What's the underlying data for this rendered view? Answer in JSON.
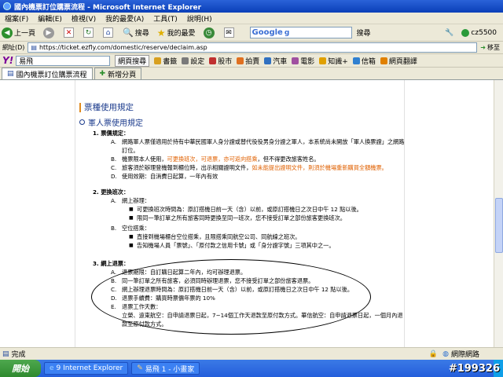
{
  "window": {
    "title": "國內機票訂位購票流程 - Microsoft Internet Explorer"
  },
  "menu": [
    "檔案(F)",
    "編輯(E)",
    "檢視(V)",
    "我的最愛(A)",
    "工具(T)",
    "說明(H)"
  ],
  "toolbar": {
    "back": "上一頁",
    "search": "搜尋",
    "favorites": "我的最愛",
    "google_search_label": "搜尋",
    "user": "cz5500"
  },
  "address": {
    "label": "網址(D)",
    "url": "https://ticket.ezfly.com/domestic/reserve/declaim.asp",
    "go": "移至"
  },
  "yahoo": {
    "query": "易飛",
    "search_btn": "網頁搜尋",
    "items": [
      "書籤",
      "設定",
      "股市",
      "拍賣",
      "汽車",
      "電影",
      "知識+",
      "信箱",
      "網頁翻譯"
    ],
    "colors": [
      "#d8a020",
      "#7a7a7a",
      "#c03030",
      "#e07020",
      "#3070c0",
      "#a050a0",
      "#e0a000",
      "#3080d0",
      "#e08000"
    ]
  },
  "tabs": [
    {
      "label": "國內機票訂位購票流程"
    },
    {
      "label": "新增分頁"
    }
  ],
  "content": {
    "section_title": "票種使用規定",
    "sub_title": "軍人票使用規定",
    "s1": {
      "header": "1.  票價規定：",
      "rows": [
        {
          "lab": "A.",
          "txt": "網路軍人票僅適用於持有中華民國軍人身分證或替代役役男身分證之軍人，本系統尚未開放「軍人換票證」之網路訂位。"
        },
        {
          "lab": "B.",
          "pre": "機票限本人使用，",
          "orange": "可更換班次，可退票，亦可返向搭乘",
          "post": "，但不得更改旅客姓名。"
        },
        {
          "lab": "C.",
          "pre": "旅客須於辦理登機報到櫃位時，出示相關證明文件，",
          "orange": "如未能提出證明文件，則須於機場重新購買全額機票。",
          "post": ""
        },
        {
          "lab": "D.",
          "txt": "使用效期：自消費日起算，一年內有效"
        }
      ]
    },
    "s2": {
      "header": "2.  更換班次：",
      "a": {
        "lab": "A.",
        "txt": "網上辦理："
      },
      "a_items": [
        "可更換班次時間為：原訂搭機日前一天（含）以前，或原訂搭機日之次日中午 12 點以後。",
        "限同一筆訂單之所有旅客同時更換至同一班次，您不接受訂單之部份旅客更換班次。"
      ],
      "b": {
        "lab": "B.",
        "txt": "空位搭乘："
      },
      "b_items": [
        "直接到機場櫃台空位搭乘，且限搭乘同航空公司、同航線之班次。",
        "告知機場人員「票號」、「原付款之信用卡號」或「身分證字號」三項其中之一。"
      ]
    },
    "s3": {
      "header": "3.  網上退票：",
      "rows": [
        {
          "lab": "A.",
          "txt": "退票期限：自訂購日起算二年內，均可辦理退票。"
        },
        {
          "lab": "B.",
          "txt": "同一筆訂單之所有旅客，必須同時辦理退票，您不接受訂單之部份旅客退票。"
        },
        {
          "lab": "C.",
          "txt": "網上辦理退票時間為：原訂搭機日前一天（含）以前，或原訂搭機日之次日中午 12 點以後。"
        },
        {
          "lab": "D.",
          "txt": "退票手續費：購買時票價年票的 10%"
        },
        {
          "lab": "E.",
          "txt": "退票工作天數："
        },
        {
          "lab": "",
          "txt": "立榮、遠東航空：自申請退票日起，7~14個工作天退款至原付款方式。華信航空：自申請退票日起，一個月內退款至原付款方式。"
        }
      ]
    }
  },
  "status": {
    "text": "完成",
    "zone": "網際網路"
  },
  "taskbar": {
    "start": "開始",
    "tasks": [
      "9 Internet Explorer",
      "易飛 1 - 小畫家"
    ]
  },
  "watermark": "#199326"
}
